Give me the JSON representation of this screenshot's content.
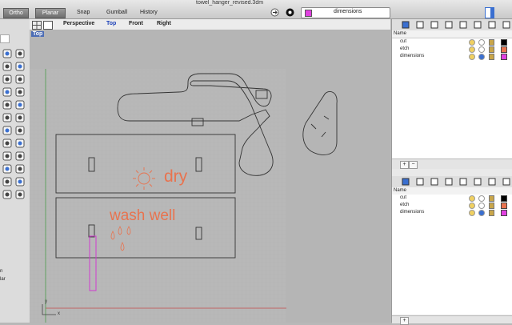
{
  "app": {
    "title": "towel_hanger_revised.3dm"
  },
  "toolbar": {
    "ortho": "Ortho",
    "planar": "Planar",
    "snap": "Snap",
    "gumball": "Gumball",
    "history": "History",
    "current_layer": "dimensions",
    "current_layer_color": "#e040e0"
  },
  "view_tabs": [
    "Perspective",
    "Top",
    "Front",
    "Right"
  ],
  "active_view": "Top",
  "viewport": {
    "label": "Top",
    "axis_y": "y",
    "axis_x": "x"
  },
  "drawing": {
    "text_dry": "dry",
    "text_wash": "wash well",
    "cut_color": "#333333",
    "etch_color": "#e8734f",
    "dim_color": "#d03cd0"
  },
  "left_panel_fragments": [
    "n",
    "lar"
  ],
  "layers_panel": {
    "header": "Name",
    "layers": [
      {
        "name": "cut",
        "color": "#000000"
      },
      {
        "name": "etch",
        "color": "#e8734f"
      },
      {
        "name": "dimensions",
        "color": "#e040e0"
      }
    ]
  },
  "layers_panel_2": {
    "header": "Name",
    "layers": [
      {
        "name": "cut",
        "color": "#000000"
      },
      {
        "name": "etch",
        "color": "#e8734f"
      },
      {
        "name": "dimensions",
        "color": "#e040e0"
      }
    ]
  },
  "panel_tab_icons": [
    "layers-icon",
    "material-icon",
    "document-icon",
    "copy-icon",
    "viewport-icon",
    "grid-icon",
    "note-icon",
    "help-icon"
  ]
}
